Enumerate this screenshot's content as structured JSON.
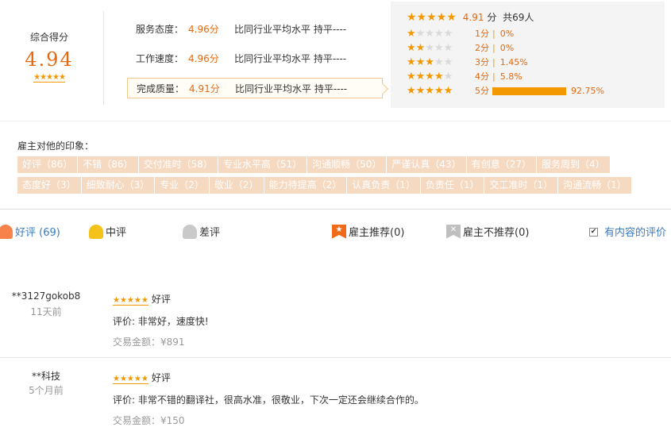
{
  "overall": {
    "label": "综合得分",
    "score": "4.94",
    "stars": "★★★★★"
  },
  "dimensions": [
    {
      "name": "服务态度：",
      "value": "4.96分",
      "compare": "比同行业平均水平 持平----"
    },
    {
      "name": "工作速度：",
      "value": "4.96分",
      "compare": "比同行业平均水平 持平----"
    },
    {
      "name": "完成质量：",
      "value": "4.91分",
      "compare": "比同行业平均水平 持平----"
    }
  ],
  "distribution": {
    "stars": "★★★★★",
    "avg": "4.91",
    "unit": "分",
    "total": "共69人",
    "rows": [
      {
        "on": "★",
        "off": "★★★★",
        "score": "1分",
        "sep": "|",
        "pct": "0%",
        "fraction": 0
      },
      {
        "on": "★★",
        "off": "★★★",
        "score": "2分",
        "sep": "|",
        "pct": "0%",
        "fraction": 0
      },
      {
        "on": "★★★",
        "off": "★★",
        "score": "3分",
        "sep": "|",
        "pct": "1.45%",
        "fraction": 0.0145
      },
      {
        "on": "★★★★",
        "off": "★",
        "score": "4分",
        "sep": "|",
        "pct": "5.8%",
        "fraction": 0.058
      },
      {
        "on": "★★★★★",
        "off": "",
        "score": "5分",
        "sep": "",
        "pct": "92.75%",
        "fraction": 0.9275
      }
    ]
  },
  "impressions": {
    "title": "雇主对他的印象：",
    "tags": [
      "好评（86）",
      "不错（86）",
      "交付准时（58）",
      "专业水平高（51）",
      "沟通顺畅（50）",
      "严谨认真（43）",
      "有创意（27）",
      "服务周到（4）",
      "态度好（3）",
      "细致耐心（3）",
      "专业（2）",
      "敬业（2）",
      "能力待提高（2）",
      "认真负责（1）",
      "负责任（1）",
      "交工准时（1）",
      "沟通流畅（1）"
    ]
  },
  "filters": {
    "good": "好评 (69)",
    "mid": "中评",
    "bad": "差评",
    "recommend": "雇主推荐(0)",
    "not_recommend": "雇主不推荐(0)",
    "has_content": "有内容的评价",
    "has_content_checked": true
  },
  "reviews": [
    {
      "user": "**3127gokob8",
      "time": "11天前",
      "stars": "★★★★★",
      "rating": "好评",
      "comment": "评价: 非常好，速度快!",
      "amount": "交易金额：¥891"
    },
    {
      "user": "**科技",
      "time": "5个月前",
      "stars": "★★★★★",
      "rating": "好评",
      "comment": "评价: 非常不错的翻译社，很高水准，很敬业，下次一定还会继续合作的。",
      "amount": "交易金额：¥150"
    }
  ],
  "colors": {
    "accent": "#e4690f",
    "star": "#f39800",
    "tag_bg": "#f5d9c1",
    "link": "#3b7bbf"
  }
}
